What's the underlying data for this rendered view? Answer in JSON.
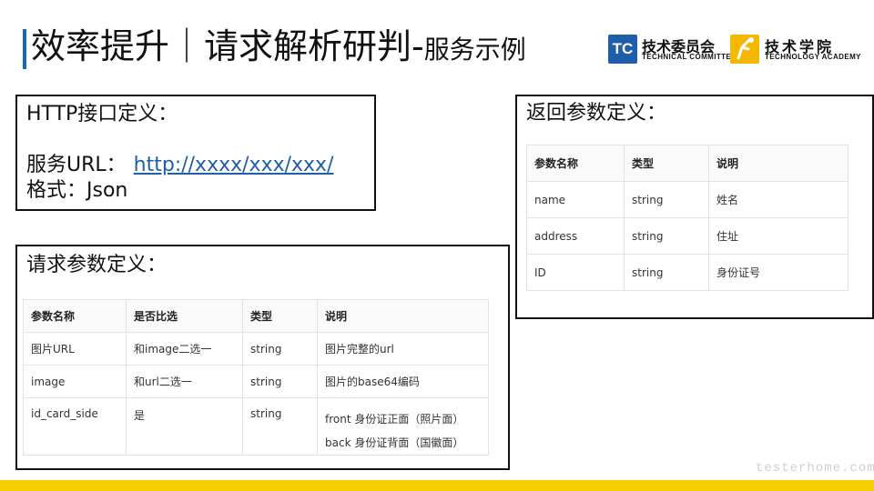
{
  "header": {
    "title_main": "效率提升｜请求解析研判-",
    "title_sub": "服务示例"
  },
  "logos": {
    "tc_mark": "TC",
    "tc_cn": "技术委员会",
    "tc_en": "TECHNICAL COMMITTEE",
    "ta_cn": "技术学院",
    "ta_en": "TECHNOLOGY ACADEMY"
  },
  "http_box": {
    "title": "HTTP接口定义：",
    "url_label": "服务URL：",
    "url": "http://xxxx/xxx/xxx/",
    "format": "格式：Json"
  },
  "request_box": {
    "title": "请求参数定义：",
    "headers": [
      "参数名称",
      "是否比选",
      "类型",
      "说明"
    ],
    "rows": [
      {
        "name": "图片URL",
        "required": "和image二选一",
        "type": "string",
        "desc": [
          "图片完整的url"
        ]
      },
      {
        "name": "image",
        "required": "和url二选一",
        "type": "string",
        "desc": [
          "图片的base64编码"
        ]
      },
      {
        "name": "id_card_side",
        "required": "是",
        "type": "string",
        "desc": [
          "front 身份证正面（照片面）",
          "back 身份证背面（国徽面）"
        ]
      }
    ]
  },
  "response_box": {
    "title": "返回参数定义：",
    "headers": [
      "参数名称",
      "类型",
      "说明"
    ],
    "rows": [
      {
        "name": "name",
        "type": "string",
        "desc": "姓名"
      },
      {
        "name": "address",
        "type": "string",
        "desc": "住址"
      },
      {
        "name": "ID",
        "type": "string",
        "desc": "身份证号"
      }
    ]
  },
  "footer": {
    "watermark": "testerhome.com",
    "accent_color": "#f5d000"
  },
  "colors": {
    "title_accent": "#1a66b8",
    "link": "#1f5ea8",
    "tc_logo": "#1f5ea8",
    "ta_logo": "#f5b800"
  }
}
